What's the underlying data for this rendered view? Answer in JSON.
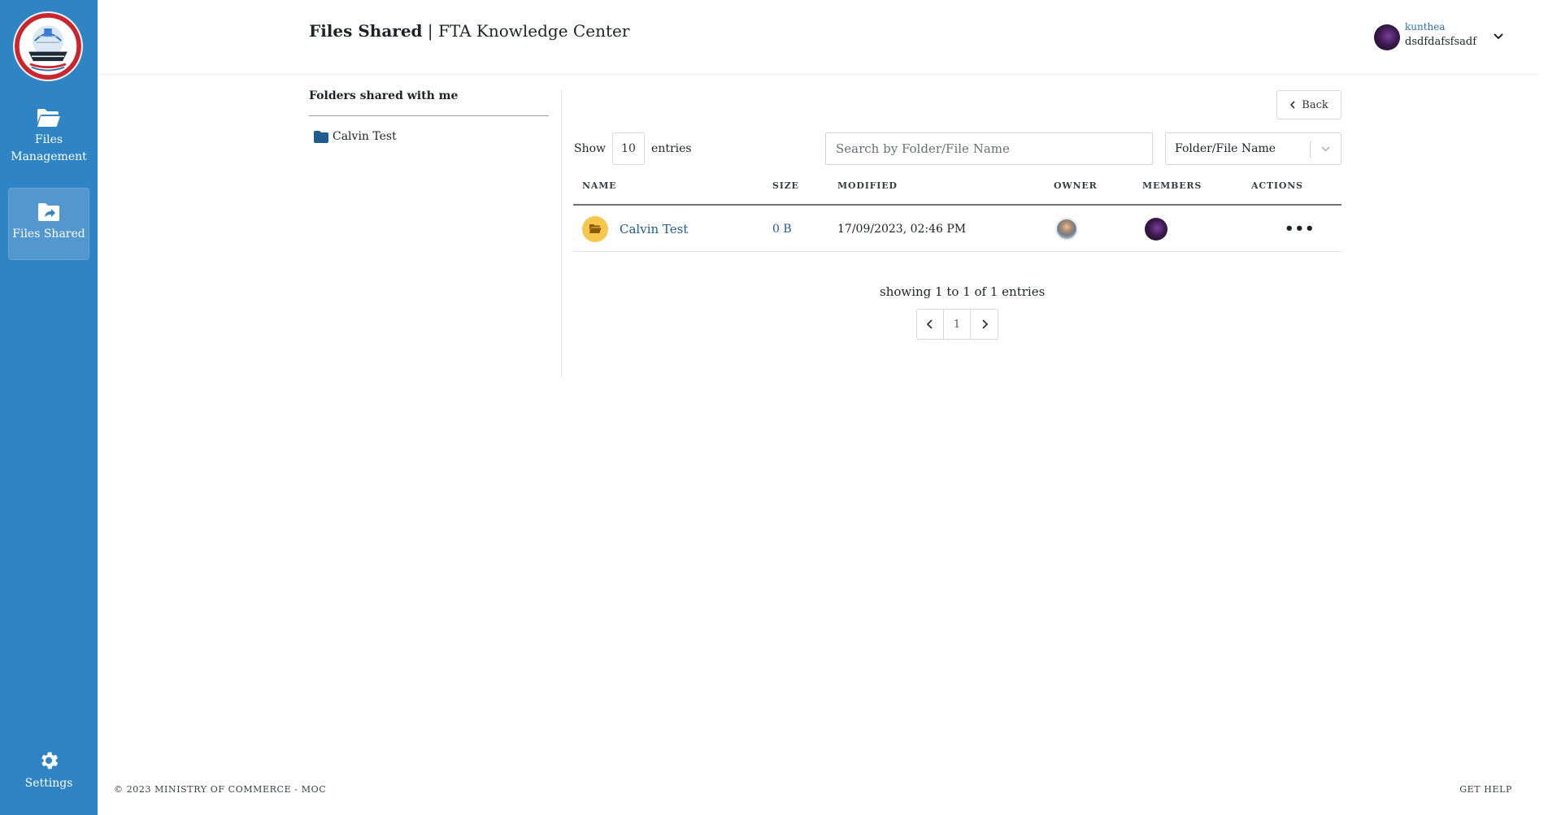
{
  "sidebar": {
    "logo_alt": "Ministry of Commerce logo",
    "items": [
      {
        "label": "Files Management",
        "icon": "folder-open-icon"
      },
      {
        "label": "Files Shared",
        "icon": "folder-share-icon",
        "active": true
      }
    ],
    "settings": {
      "label": "Settings",
      "icon": "gear-icon"
    }
  },
  "header": {
    "title_bold": "Files Shared",
    "title_rest": "| FTA Knowledge Center",
    "user": {
      "name": "kunthea",
      "subtitle": "dsdfdafsfsadf",
      "dropdown_icon": "chevron-down-icon"
    }
  },
  "left_panel": {
    "title": "Folders shared with me",
    "folders": [
      {
        "label": "Calvin Test",
        "icon": "folder-icon"
      }
    ]
  },
  "toolbar": {
    "back_label": "Back",
    "show_label": "Show",
    "entries_value": "10",
    "entries_label": "entries",
    "search_placeholder": "Search by Folder/File Name",
    "filter_value": "Folder/File Name"
  },
  "table": {
    "columns": [
      "NAME",
      "SIZE",
      "MODIFIED",
      "OWNER",
      "MEMBERS",
      "ACTIONS"
    ],
    "rows": [
      {
        "name": "Calvin Test",
        "size": "0 B",
        "modified": "17/09/2023, 02:46 PM",
        "actions": "•••"
      }
    ]
  },
  "pagination": {
    "summary": "showing 1 to 1 of 1 entries",
    "prev_icon": "chevron-left-icon",
    "page": "1",
    "next_icon": "chevron-right-icon"
  },
  "footer": {
    "copyright": "© 2023 MINISTRY OF COMMERCE - MOC",
    "help": "GET HELP"
  },
  "colors": {
    "sidebar": "#2f84c4",
    "link": "#1f5c94",
    "folder_badge": "#f7c64d",
    "folder_icon": "#1d5d8f"
  }
}
